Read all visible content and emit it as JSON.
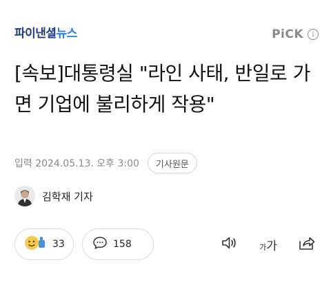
{
  "header": {
    "logo_main": "파이낸셜",
    "logo_sub": "뉴스",
    "pick_label": "PiCK",
    "info_glyph": "i"
  },
  "article": {
    "title": "[속보]대통령실 \"라인 사태, 반일로 가면 기업에 불리하게 작용\"",
    "date_label": "입력 2024.05.13. 오후 3:00",
    "source_button": "기사원문"
  },
  "reporter": {
    "name": "김학재 기자"
  },
  "actions": {
    "reaction_count": "33",
    "comment_count": "158",
    "font_small": "가",
    "font_big": "가"
  },
  "icons": {
    "reaction": "emoji-reaction-icon",
    "comment": "speech-bubble-icon",
    "audio": "speaker-icon",
    "font": "font-size-icon",
    "share": "share-icon",
    "info": "info-icon"
  },
  "colors": {
    "logo_dark": "#1f3a93",
    "logo_light": "#2b7de9",
    "muted": "#8a8a8a",
    "reaction_yellow": "#f7c948",
    "reaction_blue": "#4a90e2"
  }
}
